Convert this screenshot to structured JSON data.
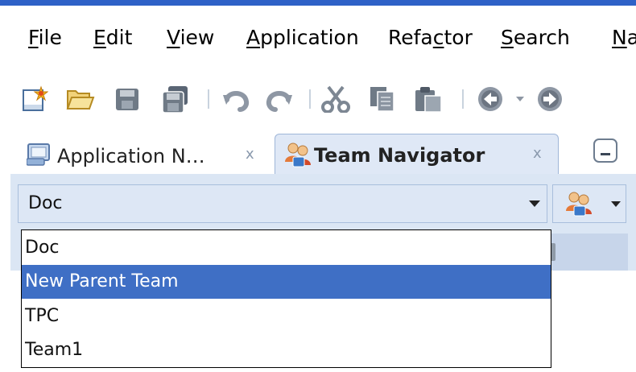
{
  "menu": {
    "items": [
      {
        "label": "File",
        "mnemonic": "F",
        "rest": "ile"
      },
      {
        "label": "Edit",
        "mnemonic": "E",
        "rest": "dit"
      },
      {
        "label": "View",
        "mnemonic": "V",
        "rest": "iew"
      },
      {
        "label": "Application",
        "mnemonic": "A",
        "rest": "pplication"
      },
      {
        "label": "Refactor",
        "pre": "Refa",
        "mnemonic": "c",
        "rest": "tor"
      },
      {
        "label": "Search",
        "mnemonic": "S",
        "rest": "earch"
      },
      {
        "label": "Na",
        "mnemonic": "N",
        "rest": "a"
      }
    ]
  },
  "toolbar": {
    "icons": [
      "new-icon",
      "open-folder-icon",
      "save-icon",
      "save-all-icon",
      "undo-icon",
      "redo-icon",
      "cut-icon",
      "copy-icon",
      "paste-icon",
      "back-icon",
      "forward-icon"
    ]
  },
  "tabs": [
    {
      "label": "Application N…",
      "close": "x",
      "icon": "application-navigator-icon",
      "active": false
    },
    {
      "label": "Team Navigator",
      "close": "x",
      "icon": "team-icon",
      "active": true
    }
  ],
  "team_selector": {
    "selected": "Doc",
    "options": [
      "Doc",
      "New  Parent Team",
      "TPC",
      "Team1"
    ],
    "highlighted_index": 1
  },
  "colors": {
    "selection": "#3f6fc5",
    "panel": "#dbe6f4",
    "accent": "#2e61c7"
  }
}
